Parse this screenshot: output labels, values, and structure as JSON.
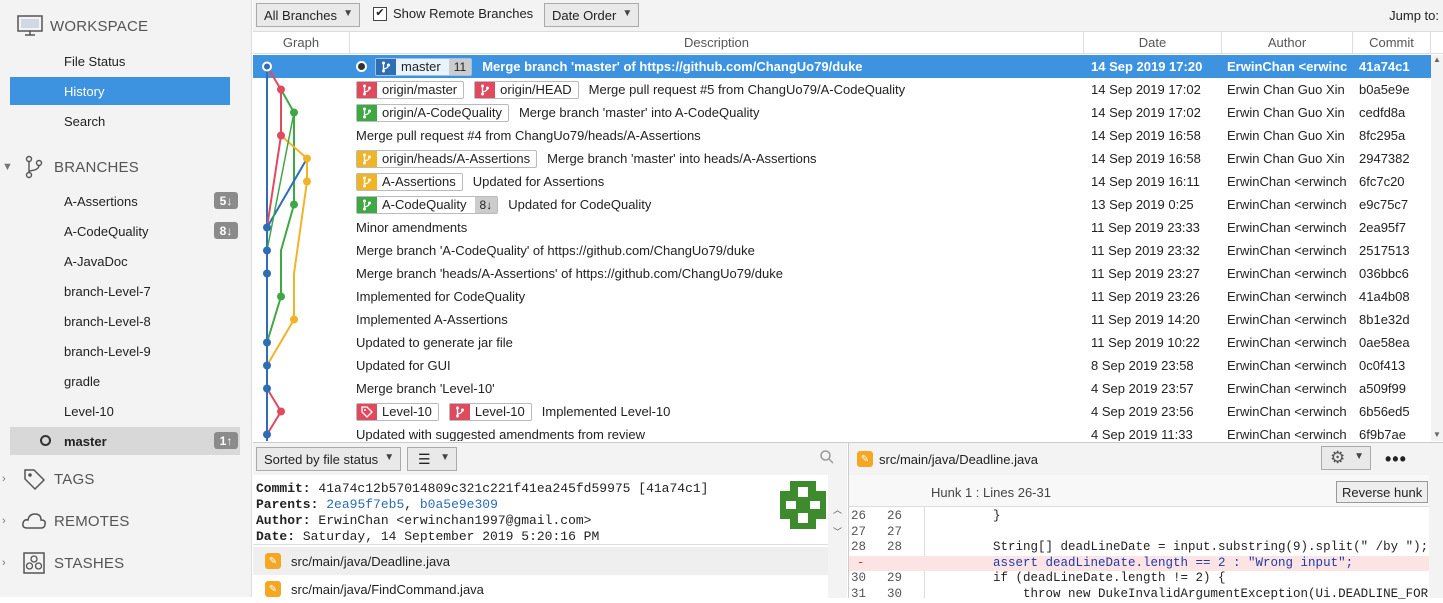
{
  "sidebar": {
    "workspace": "WORKSPACE",
    "nav": [
      "File Status",
      "History",
      "Search"
    ],
    "branches_title": "BRANCHES",
    "branches": [
      {
        "name": "A-Assertions",
        "badge": "5↓"
      },
      {
        "name": "A-CodeQuality",
        "badge": "8↓"
      },
      {
        "name": "A-JavaDoc",
        "badge": ""
      },
      {
        "name": "branch-Level-7",
        "badge": ""
      },
      {
        "name": "branch-Level-8",
        "badge": ""
      },
      {
        "name": "branch-Level-9",
        "badge": ""
      },
      {
        "name": "gradle",
        "badge": ""
      },
      {
        "name": "Level-10",
        "badge": ""
      },
      {
        "name": "master",
        "badge": "1↑"
      }
    ],
    "tags": "TAGS",
    "remotes": "REMOTES",
    "stashes": "STASHES"
  },
  "toolbar": {
    "branches_dd": "All Branches",
    "show_remote": "Show Remote Branches",
    "order_dd": "Date Order",
    "jump": "Jump to:"
  },
  "columns": {
    "graph": "Graph",
    "description": "Description",
    "date": "Date",
    "author": "Author",
    "commit": "Commit"
  },
  "commits": [
    {
      "tags": [
        {
          "label": "master",
          "color": "#2f6db5",
          "count": "11"
        }
      ],
      "msg": "Merge branch 'master' of https://github.com/ChangUo79/duke",
      "date": "14 Sep 2019 17:20",
      "author": "ErwinChan <erwinc",
      "hash": "41a74c1"
    },
    {
      "tags": [
        {
          "label": "origin/master",
          "color": "#e04a5f",
          "count": ""
        },
        {
          "label": "origin/HEAD",
          "color": "#e04a5f",
          "count": ""
        }
      ],
      "msg": "Merge pull request #5 from ChangUo79/A-CodeQuality",
      "date": "14 Sep 2019 17:02",
      "author": "Erwin Chan Guo Xin",
      "hash": "b0a5e9e"
    },
    {
      "tags": [
        {
          "label": "origin/A-CodeQuality",
          "color": "#3fa845",
          "count": ""
        }
      ],
      "msg": "Merge branch 'master' into A-CodeQuality",
      "date": "14 Sep 2019 17:02",
      "author": "Erwin Chan Guo Xin",
      "hash": "cedfd8a"
    },
    {
      "tags": [],
      "msg": "Merge pull request #4 from ChangUo79/heads/A-Assertions",
      "date": "14 Sep 2019 16:58",
      "author": "Erwin Chan Guo Xin",
      "hash": "8fc295a"
    },
    {
      "tags": [
        {
          "label": "origin/heads/A-Assertions",
          "color": "#f0b429",
          "count": ""
        }
      ],
      "msg": "Merge branch 'master' into heads/A-Assertions",
      "date": "14 Sep 2019 16:58",
      "author": "Erwin Chan Guo Xin",
      "hash": "2947382"
    },
    {
      "tags": [
        {
          "label": "A-Assertions",
          "color": "#f0b429",
          "count": ""
        }
      ],
      "msg": "Updated for Assertions",
      "date": "14 Sep 2019 16:11",
      "author": "ErwinChan <erwinch",
      "hash": "6fc7c20"
    },
    {
      "tags": [
        {
          "label": "A-CodeQuality",
          "color": "#3fa845",
          "count": "8↓"
        }
      ],
      "msg": "Updated for CodeQuality",
      "date": "13 Sep 2019 0:25",
      "author": "ErwinChan <erwinch",
      "hash": "e9c75c7"
    },
    {
      "tags": [],
      "msg": "Minor amendments",
      "date": "11 Sep 2019 23:33",
      "author": "ErwinChan <erwinch",
      "hash": "2ea95f7"
    },
    {
      "tags": [],
      "msg": "Merge branch 'A-CodeQuality' of https://github.com/ChangUo79/duke",
      "date": "11 Sep 2019 23:32",
      "author": "ErwinChan <erwinch",
      "hash": "2517513"
    },
    {
      "tags": [],
      "msg": "Merge branch 'heads/A-Assertions' of https://github.com/ChangUo79/duke",
      "date": "11 Sep 2019 23:27",
      "author": "ErwinChan <erwinch",
      "hash": "036bbc6"
    },
    {
      "tags": [],
      "msg": "Implemented for CodeQuality",
      "date": "11 Sep 2019 23:26",
      "author": "ErwinChan <erwinch",
      "hash": "41a4b08"
    },
    {
      "tags": [],
      "msg": "Implemented A-Assertions",
      "date": "11 Sep 2019 14:20",
      "author": "ErwinChan <erwinch",
      "hash": "8b1e32d"
    },
    {
      "tags": [],
      "msg": "Updated to generate jar file",
      "date": "11 Sep 2019 10:22",
      "author": "ErwinChan <erwinch",
      "hash": "0ae58ea"
    },
    {
      "tags": [],
      "msg": "Updated for GUI",
      "date": "8 Sep 2019 23:58",
      "author": "ErwinChan <erwinch",
      "hash": "0c0f413"
    },
    {
      "tags": [],
      "msg": "Merge branch 'Level-10'",
      "date": "4 Sep 2019 23:57",
      "author": "ErwinChan <erwinch",
      "hash": "a509f99"
    },
    {
      "tags": [
        {
          "label": "Level-10",
          "color": "#e04a5f",
          "count": "",
          "tagicon": true
        },
        {
          "label": "Level-10",
          "color": "#e04a5f",
          "count": ""
        }
      ],
      "msg": "Implemented Level-10",
      "date": "4 Sep 2019 23:56",
      "author": "ErwinChan <erwinch",
      "hash": "6b56ed5"
    },
    {
      "tags": [],
      "msg": "Updated with suggested amendments from review",
      "date": "4 Sep 2019 11:33",
      "author": "ErwinChan <erwinch",
      "hash": "6f9b7ae"
    }
  ],
  "files_toolbar": {
    "sort": "Sorted by file status"
  },
  "details": {
    "commit_label": "Commit:",
    "commit": "41a74c12b57014809c321c221f41ea245fd59975 [41a74c1]",
    "parents_label": "Parents:",
    "parent1": "2ea95f7eb5",
    "parent2": "b0a5e9e309",
    "author_label": "Author:",
    "author": "ErwinChan <erwinchan1997@gmail.com>",
    "date_label": "Date:",
    "date": "Saturday, 14 September 2019 5:20:16 PM"
  },
  "files": [
    "src/main/java/Deadline.java",
    "src/main/java/FindCommand.java"
  ],
  "diff": {
    "file": "src/main/java/Deadline.java",
    "hunk": "Hunk 1 : Lines 26-31",
    "reverse": "Reverse hunk",
    "lines": [
      {
        "a": "26",
        "b": "26",
        "t": "        }",
        "kind": "ctx"
      },
      {
        "a": "27",
        "b": "27",
        "t": "",
        "kind": "ctx"
      },
      {
        "a": "28",
        "b": "28",
        "t": "        String[] deadLineDate = input.substring(9).split(\" /by \");",
        "kind": "ctx"
      },
      {
        "a": "29",
        "b": "-",
        "t": "        assert deadLineDate.length == 2 : \"Wrong input\";",
        "kind": "del"
      },
      {
        "a": "30",
        "b": "29",
        "t": "        if (deadLineDate.length != 2) {",
        "kind": "ctx"
      },
      {
        "a": "31",
        "b": "30",
        "t": "            throw new DukeInvalidArgumentException(Ui.DEADLINE_FOR",
        "kind": "ctx"
      }
    ]
  }
}
